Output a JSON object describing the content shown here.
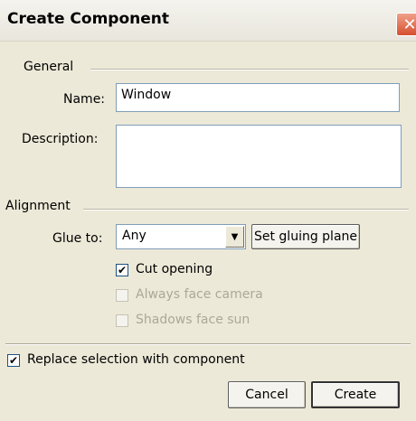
{
  "window": {
    "title": "Create Component",
    "close_glyph": "✕"
  },
  "general": {
    "group_label": "General",
    "name_label": "Name:",
    "name_value": "Window",
    "description_label": "Description:",
    "description_value": ""
  },
  "alignment": {
    "group_label": "Alignment",
    "glue_label": "Glue to:",
    "glue_value": "Any",
    "glue_arrow": "▼",
    "set_plane_label": "Set gluing plane",
    "cut_opening": {
      "label": "Cut opening",
      "checked": true,
      "enabled": true
    },
    "face_camera": {
      "label": "Always face camera",
      "checked": false,
      "enabled": false
    },
    "shadows_sun": {
      "label": "Shadows face sun",
      "checked": false,
      "enabled": false
    }
  },
  "replace": {
    "label": "Replace selection with component",
    "checked": true
  },
  "buttons": {
    "cancel": "Cancel",
    "create": "Create"
  },
  "check_glyph": "✔"
}
